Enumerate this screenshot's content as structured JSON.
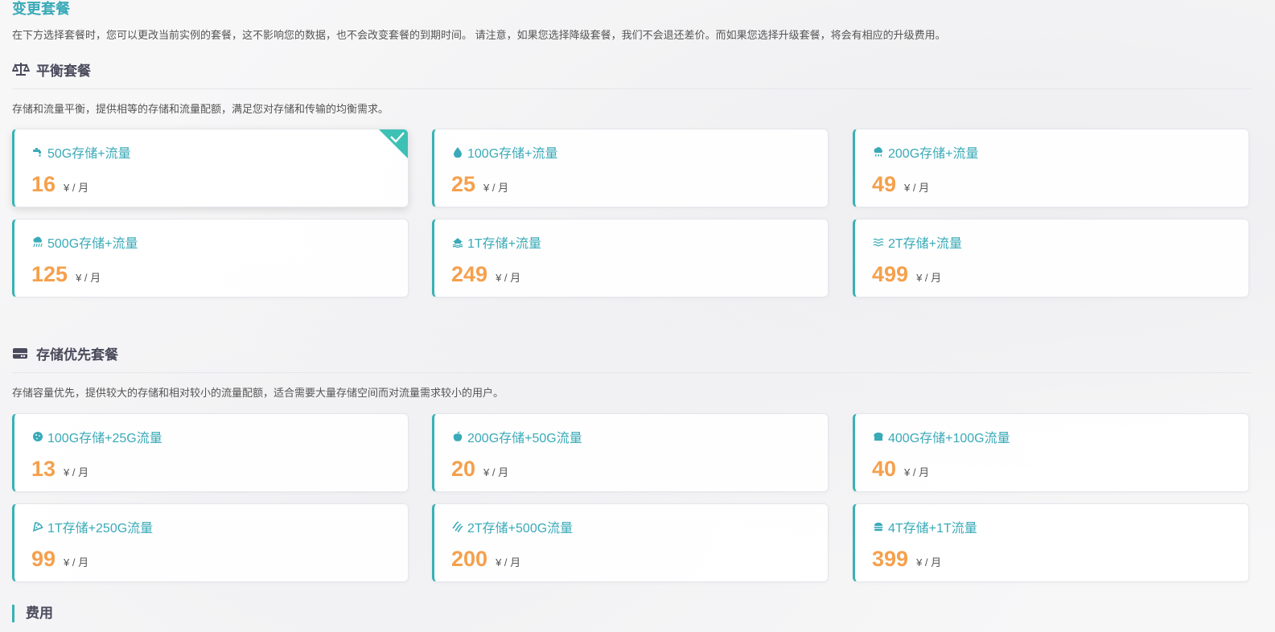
{
  "title": "变更套餐",
  "description": "在下方选择套餐时，您可以更改当前实例的套餐，这不影响您的数据，也不会改变套餐的到期时间。 请注意，如果您选择降级套餐，我们不会退还差价。而如果您选择升级套餐，将会有相应的升级费用。",
  "sections": [
    {
      "icon": "balance-scale-icon",
      "title": "平衡套餐",
      "description": "存储和流量平衡，提供相等的存储和流量配额，满足您对存储和传输的均衡需求。",
      "plans": [
        {
          "icon": "faucet-icon",
          "name": "50G存储+流量",
          "price": "16",
          "unit": "¥ / 月",
          "selected": true
        },
        {
          "icon": "droplet-icon",
          "name": "100G存储+流量",
          "price": "25",
          "unit": "¥ / 月",
          "selected": false
        },
        {
          "icon": "cloud-rain-icon",
          "name": "200G存储+流量",
          "price": "49",
          "unit": "¥ / 月",
          "selected": false
        },
        {
          "icon": "cloud-showers-icon",
          "name": "500G存储+流量",
          "price": "125",
          "unit": "¥ / 月",
          "selected": false
        },
        {
          "icon": "house-flood-icon",
          "name": "1T存储+流量",
          "price": "249",
          "unit": "¥ / 月",
          "selected": false
        },
        {
          "icon": "water-waves-icon",
          "name": "2T存储+流量",
          "price": "499",
          "unit": "¥ / 月",
          "selected": false
        }
      ]
    },
    {
      "icon": "hard-drive-icon",
      "title": "存储优先套餐",
      "description": "存储容量优先，提供较大的存储和相对较小的流量配额，适合需要大量存储空间而对流量需求较小的用户。",
      "plans": [
        {
          "icon": "cookie-icon",
          "name": "100G存储+25G流量",
          "price": "13",
          "unit": "¥ / 月",
          "selected": false
        },
        {
          "icon": "apple-icon",
          "name": "200G存储+50G流量",
          "price": "20",
          "unit": "¥ / 月",
          "selected": false
        },
        {
          "icon": "bread-icon",
          "name": "400G存储+100G流量",
          "price": "40",
          "unit": "¥ / 月",
          "selected": false
        },
        {
          "icon": "pizza-slice-icon",
          "name": "1T存储+250G流量",
          "price": "99",
          "unit": "¥ / 月",
          "selected": false
        },
        {
          "icon": "bacon-icon",
          "name": "2T存储+500G流量",
          "price": "200",
          "unit": "¥ / 月",
          "selected": false
        },
        {
          "icon": "burger-icon",
          "name": "4T存储+1T流量",
          "price": "399",
          "unit": "¥ / 月",
          "selected": false
        }
      ]
    }
  ],
  "fee_title": "费用",
  "colors": {
    "accent": "#39aab7",
    "price": "#f5a04c",
    "check": "#3cc1b4"
  }
}
